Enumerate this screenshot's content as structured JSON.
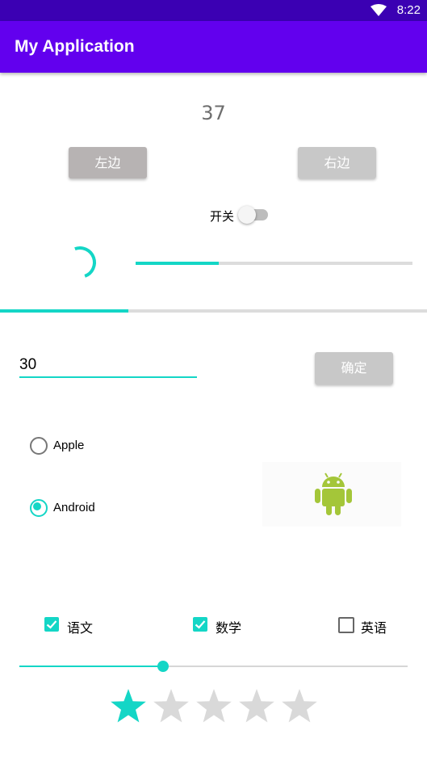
{
  "status_bar": {
    "time": "8:22",
    "wifi_icon": "wifi-icon"
  },
  "app_bar": {
    "title": "My Application"
  },
  "counter": {
    "value": "37"
  },
  "buttons": {
    "left": "左边",
    "right": "右边",
    "confirm": "确定"
  },
  "switch": {
    "label": "开关",
    "on": false
  },
  "progress": {
    "horizontal_fraction": 0.3,
    "full_width_fraction": 0.3
  },
  "input": {
    "value": "30"
  },
  "radio": [
    {
      "label": "Apple",
      "checked": false
    },
    {
      "label": "Android",
      "checked": true
    }
  ],
  "image": {
    "icon": "android-robot-icon"
  },
  "checkboxes": [
    {
      "label": "语文",
      "checked": true
    },
    {
      "label": "数学",
      "checked": true
    },
    {
      "label": "英语",
      "checked": false
    }
  ],
  "seekbar": {
    "fraction": 0.37
  },
  "rating": {
    "value": 1,
    "max": 5
  },
  "colors": {
    "primary": "#6200ee",
    "primary_dark": "#3700b3",
    "accent": "#03dac5"
  }
}
